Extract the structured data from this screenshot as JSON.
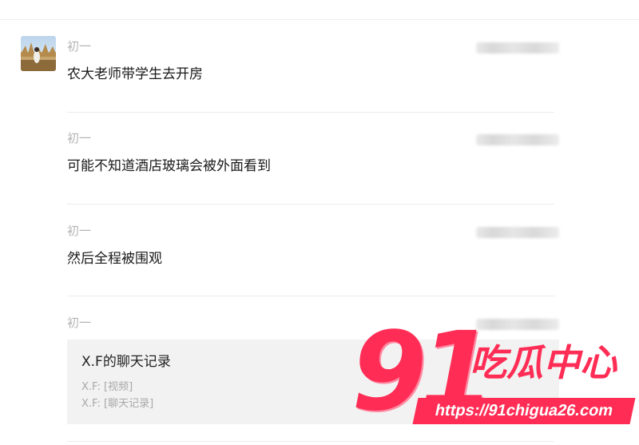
{
  "messages": [
    {
      "sender": "初一",
      "text": "农大老师带学生去开房"
    },
    {
      "sender": "初一",
      "text": "可能不知道酒店玻璃会被外面看到"
    },
    {
      "sender": "初一",
      "text": "然后全程被围观"
    },
    {
      "sender": "初一"
    }
  ],
  "record_card": {
    "title": "X.F的聊天记录",
    "lines": [
      "X.F: [视频]",
      "X.F: [聊天记录]"
    ]
  },
  "watermark": {
    "number": "91",
    "name": "吃瓜中心",
    "url": "https://91chigua26.com"
  },
  "colors": {
    "watermark": "#ff2d55",
    "card_bg": "#f2f2f2",
    "sender_text": "#b4b4b4"
  }
}
